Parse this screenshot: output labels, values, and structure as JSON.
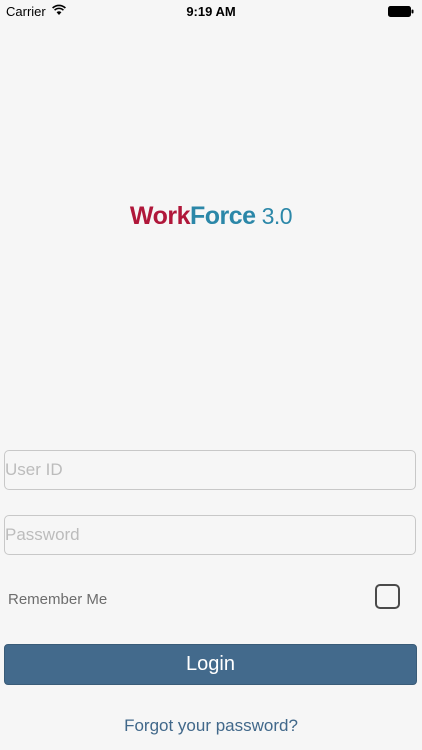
{
  "status_bar": {
    "carrier": "Carrier",
    "time": "9:19 AM",
    "wifi_icon": "wifi-icon",
    "battery_icon": "battery-icon"
  },
  "logo": {
    "part1": "Work",
    "part2": "Force",
    "version": "3.0",
    "colors": {
      "work": "#b0173a",
      "force": "#2b87a8"
    }
  },
  "form": {
    "user_id_placeholder": "User ID",
    "user_id_value": "",
    "password_placeholder": "Password",
    "password_value": "",
    "remember_label": "Remember Me",
    "remember_checked": false,
    "login_label": "Login",
    "forgot_label": "Forgot your password?"
  },
  "colors": {
    "background": "#f6f6f6",
    "primary_button": "#436a8c",
    "link": "#41688a"
  }
}
